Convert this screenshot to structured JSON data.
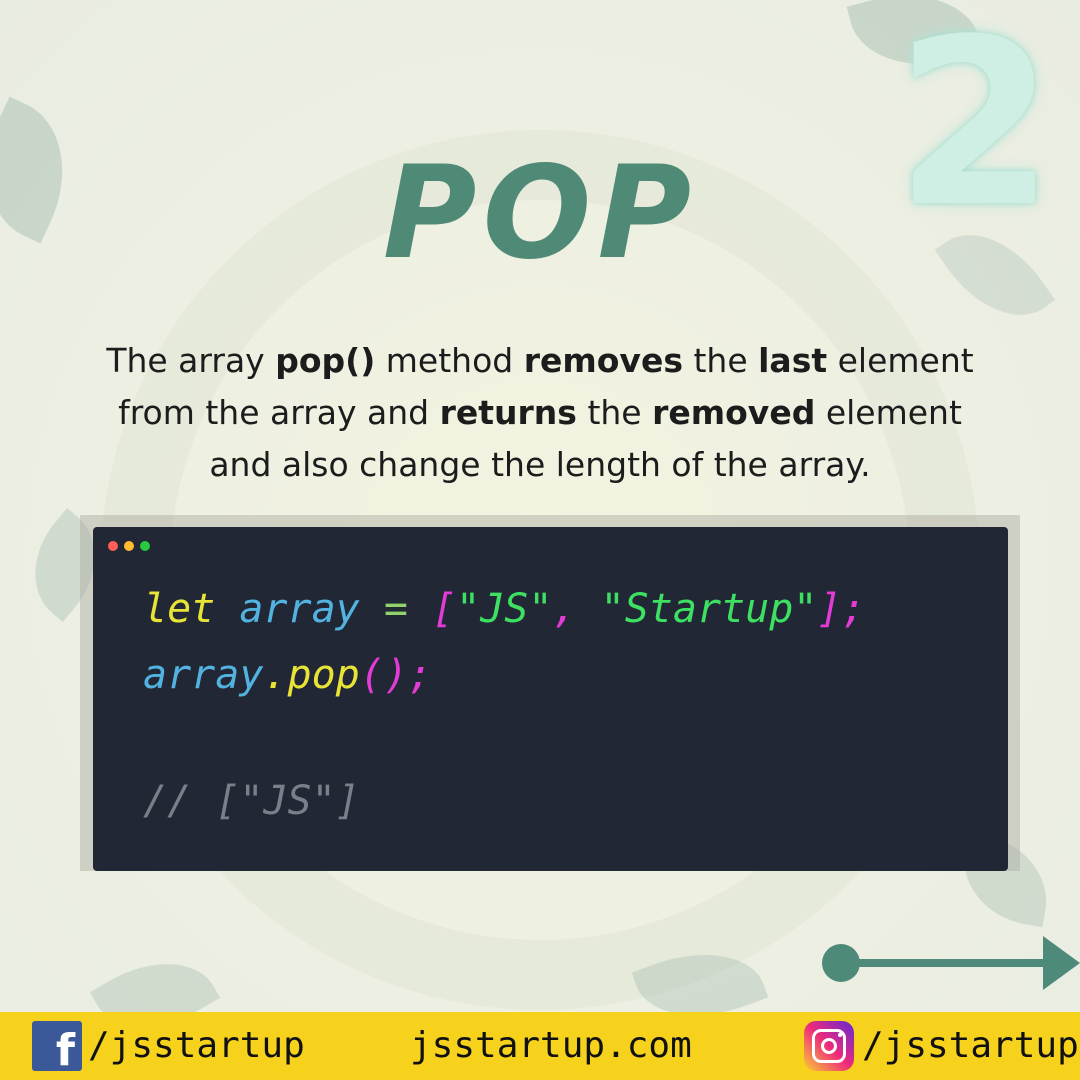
{
  "slide_number": "2",
  "title": "POP",
  "description": {
    "t1": "The array ",
    "b1": "pop()",
    "t2": " method ",
    "b2": "removes",
    "t3": " the ",
    "b3": "last",
    "t4": " element from the array and ",
    "b4": "returns",
    "t5": " the ",
    "b5": "removed",
    "t6": " element and also change the length of the array."
  },
  "code": {
    "line1": {
      "kw": "let",
      "sp1": " ",
      "var": "array",
      "sp2": " ",
      "op": "=",
      "sp3": " ",
      "br_open": "[",
      "str1": "\"JS\"",
      "comma": ", ",
      "str2": "\"Startup\"",
      "br_close": "];"
    },
    "line2": {
      "var": "array",
      "method": ".pop",
      "parens": "();"
    },
    "line3": {
      "comment": "// [\"JS\"]"
    }
  },
  "footer": {
    "facebook_handle": "/jsstartup",
    "website": "jsstartup.com",
    "instagram_handle": "/jsstartup"
  },
  "icons": {
    "facebook": "facebook-icon",
    "instagram": "instagram-icon",
    "next": "arrow-right-icon"
  },
  "colors": {
    "accent": "#4f8a76",
    "footer_bg": "#f6d21c",
    "code_bg": "#212734"
  }
}
